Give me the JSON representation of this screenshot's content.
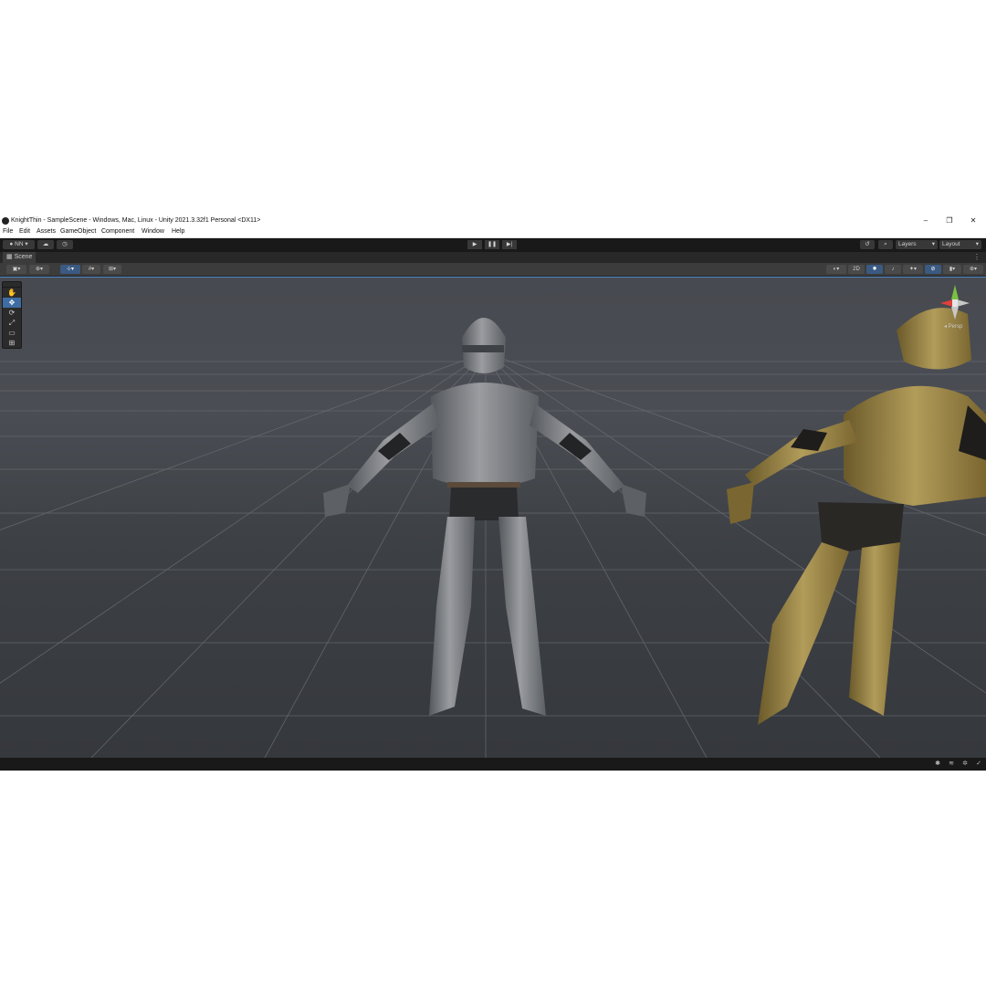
{
  "window": {
    "title": "KnightThin - SampleScene - Windows, Mac, Linux - Unity 2021.3.32f1 Personal <DX11>",
    "controls": [
      "–",
      "❐",
      "✕"
    ]
  },
  "menu": [
    "File",
    "Edit",
    "Assets",
    "GameObject",
    "Component",
    "Window",
    "Help"
  ],
  "toolbar": {
    "account": "NN ▾",
    "cloud_icon": "cloud-icon",
    "collab_icon": "clock-icon",
    "play": "▶",
    "pause": "❚❚",
    "step": "▶|",
    "layers": "Layers",
    "layout": "Layout"
  },
  "scene_tab": {
    "label": "Scene",
    "menu": "⋮"
  },
  "scene_toolbar": {
    "toggle_2d": "2D",
    "persp_label": "◂ Persp"
  },
  "tools": [
    "✋",
    "✥",
    "⟳",
    "⤢",
    "▭",
    "⊞"
  ],
  "colors": {
    "accent_blue": "#3f6da3",
    "viewport_border": "#4e88c8",
    "armor_silver": "#7a7c80",
    "armor_gold": "#9a8448",
    "gizmo_y": "#7ac143",
    "gizmo_x": "#e0413a"
  }
}
